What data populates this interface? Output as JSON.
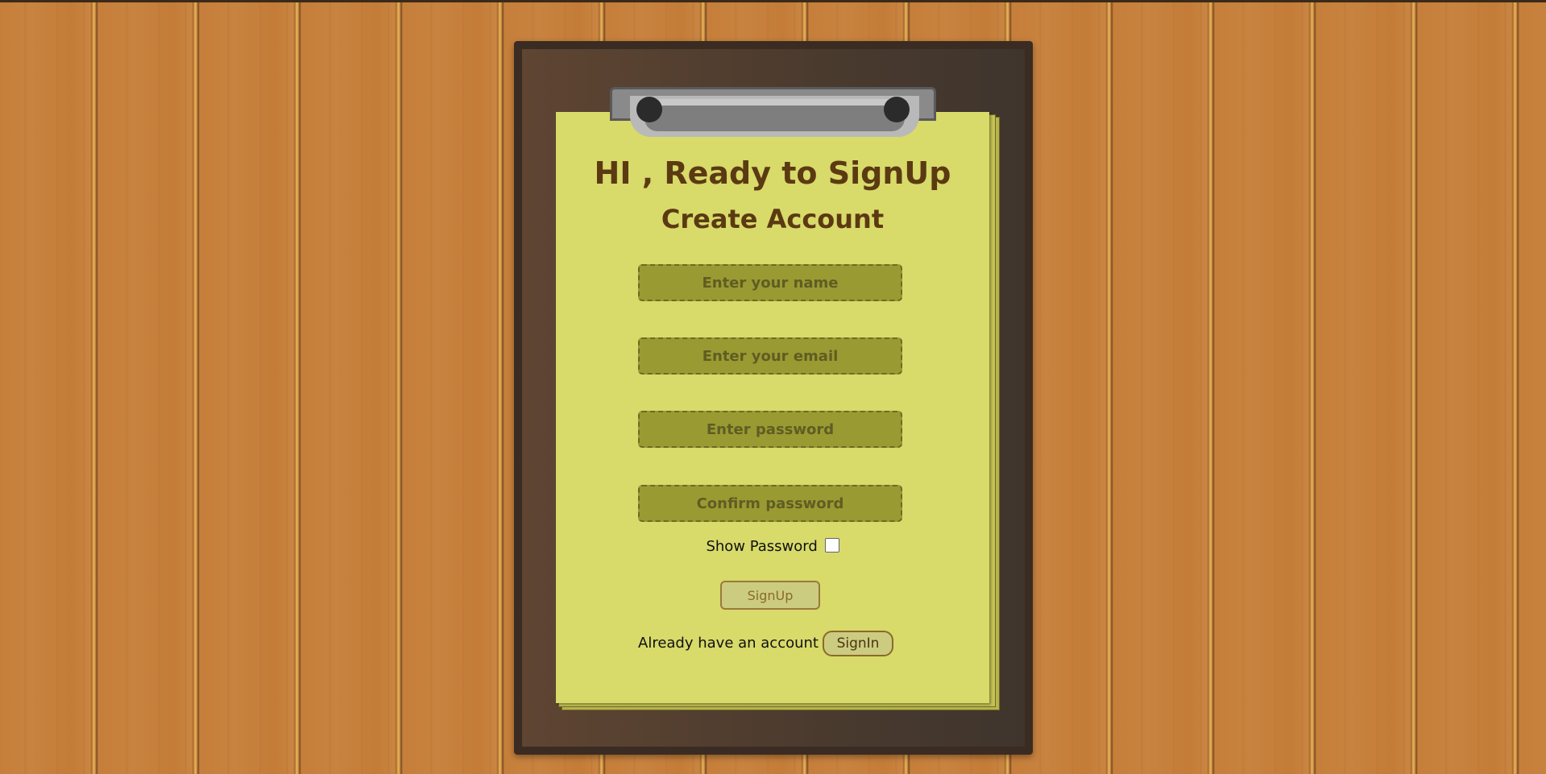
{
  "heading": "HI , Ready to SignUp",
  "subheading": "Create Account",
  "fields": {
    "name_placeholder": "Enter your name",
    "email_placeholder": "Enter your email",
    "password_placeholder": "Enter password",
    "confirm_placeholder": "Confirm password"
  },
  "show_password": {
    "label": "Show Password",
    "checked": false
  },
  "signup_label": "SignUp",
  "already_text": "Already have an account",
  "signin_label": "SignIn",
  "colors": {
    "wall": "#c8803a",
    "board": "#4a3a2e",
    "paper": "#d8da6a",
    "field": "#9a9a33",
    "heading": "#5b3a12"
  }
}
